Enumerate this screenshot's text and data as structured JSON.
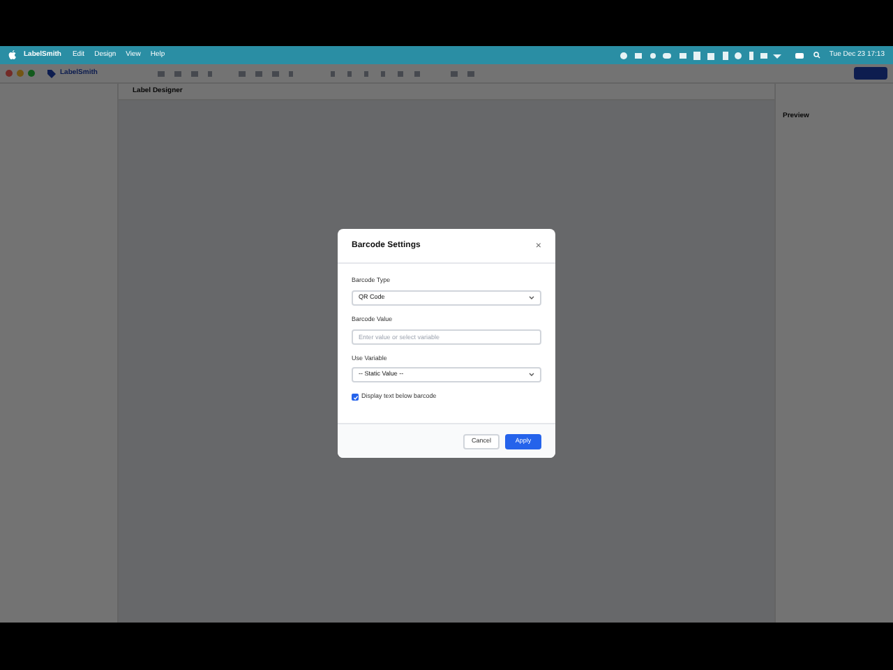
{
  "menubar": {
    "app_name": "LabelSmith",
    "menus": [
      "Edit",
      "Design",
      "View",
      "Help"
    ],
    "clock": "Tue Dec 23 17:13"
  },
  "app": {
    "title": "LabelSmith",
    "canvas_title": "Label Designer",
    "right_panel_title": "Preview"
  },
  "dialog": {
    "title": "Barcode Settings",
    "close": "×",
    "fields": [
      {
        "kind": "select",
        "label": "Barcode Type",
        "value": "QR Code"
      },
      {
        "kind": "input",
        "label": "Barcode Value",
        "placeholder": "Enter value or select variable"
      },
      {
        "kind": "select",
        "label": "Use Variable",
        "value": "-- Static Value --"
      }
    ],
    "checkbox": {
      "label": "Display text below barcode",
      "checked": true
    },
    "buttons": [
      {
        "label": "Cancel",
        "kind": "secondary"
      },
      {
        "label": "Apply",
        "kind": "primary"
      }
    ]
  }
}
